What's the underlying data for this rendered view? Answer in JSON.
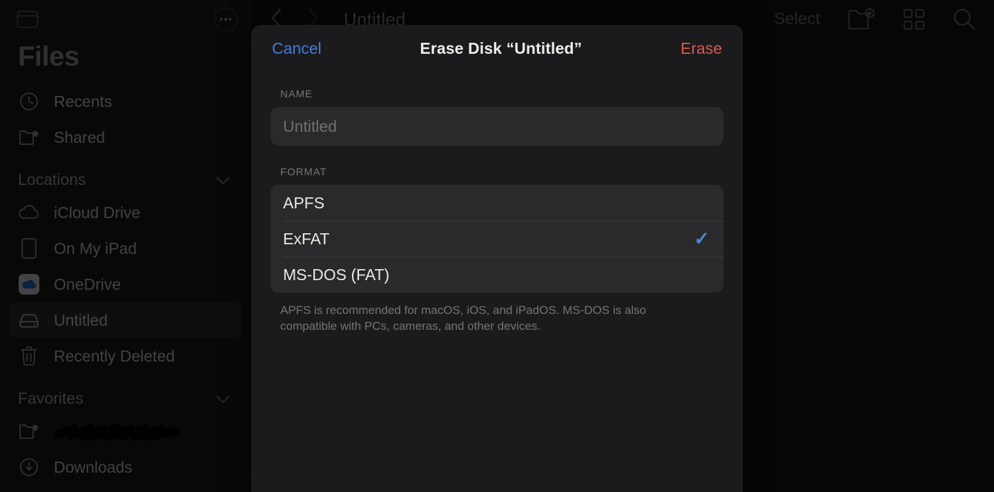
{
  "sidebar": {
    "title": "Files",
    "toggle_icon": "sidebar-toggle-icon",
    "more_icon": "ellipsis-circle-icon",
    "top_items": [
      {
        "label": "Recents",
        "icon": "clock-icon"
      },
      {
        "label": "Shared",
        "icon": "shared-folder-icon"
      }
    ],
    "sections": [
      {
        "title": "Locations",
        "chevron": "chevron-down-icon",
        "items": [
          {
            "label": "iCloud Drive",
            "icon": "cloud-icon",
            "selected": false
          },
          {
            "label": "On My iPad",
            "icon": "ipad-icon",
            "selected": false
          },
          {
            "label": "OneDrive",
            "icon": "onedrive-icon",
            "selected": false
          },
          {
            "label": "Untitled",
            "icon": "external-drive-icon",
            "selected": true
          },
          {
            "label": "Recently Deleted",
            "icon": "trash-icon",
            "selected": false
          }
        ]
      },
      {
        "title": "Favorites",
        "chevron": "chevron-down-icon",
        "items": [
          {
            "label": "",
            "icon": "shared-folder-icon",
            "redacted": true
          },
          {
            "label": "Downloads",
            "icon": "download-circle-icon",
            "selected": false
          }
        ]
      }
    ]
  },
  "content_bar": {
    "back_icon": "chevron-left-icon",
    "forward_icon": "chevron-right-icon",
    "title": "Untitled",
    "select_label": "Select",
    "new_folder_icon": "new-folder-icon",
    "grid_view_icon": "grid-view-icon",
    "search_icon": "search-icon"
  },
  "modal": {
    "cancel_label": "Cancel",
    "title": "Erase Disk “Untitled”",
    "erase_label": "Erase",
    "name_section_label": "NAME",
    "name_value": "",
    "name_placeholder": "Untitled",
    "format_section_label": "FORMAT",
    "format_options": [
      {
        "label": "APFS",
        "selected": false
      },
      {
        "label": "ExFAT",
        "selected": true
      },
      {
        "label": "MS-DOS (FAT)",
        "selected": false
      }
    ],
    "checkmark_glyph": "✓",
    "footer_note": "APFS is recommended for macOS, iOS, and iPadOS. MS-DOS is also compatible with PCs, cameras, and other devices."
  },
  "colors": {
    "accent_blue": "#3d7ddd",
    "destructive_red": "#d85a4e",
    "check_blue": "#4b86cc",
    "modal_bg": "#1b1b1d",
    "field_bg": "#2a2a2c"
  }
}
